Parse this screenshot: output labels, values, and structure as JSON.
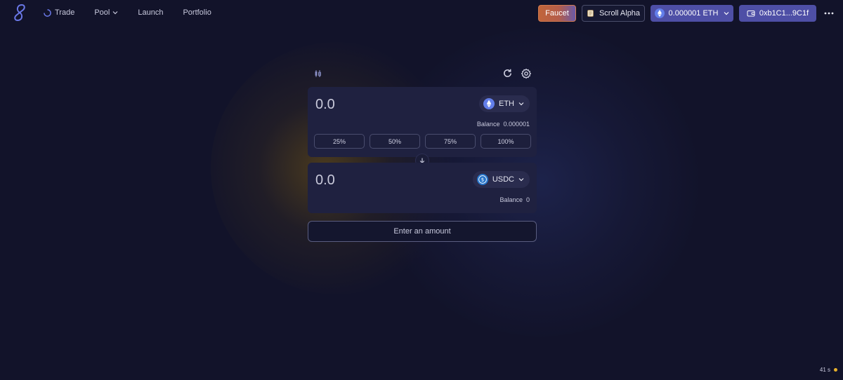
{
  "nav": {
    "items": [
      {
        "label": "Trade",
        "icon": "spinner-icon"
      },
      {
        "label": "Pool",
        "icon": "chevron-down-icon"
      },
      {
        "label": "Launch"
      },
      {
        "label": "Portfolio"
      }
    ]
  },
  "header": {
    "faucet_label": "Faucet",
    "network_label": "Scroll Alpha",
    "balance_label": "0.000001 ETH",
    "wallet_label": "0xb1C1...9C1f"
  },
  "swap": {
    "from": {
      "amount": "0.0",
      "token": "ETH",
      "balance_label": "Balance",
      "balance_value": "0.000001",
      "percent_buttons": [
        "25%",
        "50%",
        "75%",
        "100%"
      ]
    },
    "to": {
      "amount": "0.0",
      "token": "USDC",
      "balance_label": "Balance",
      "balance_value": "0"
    },
    "submit_label": "Enter an amount"
  },
  "status": {
    "block_time": "41 s",
    "dot_color": "#e8b12c"
  },
  "colors": {
    "accent": "#4e4fa6",
    "background": "#12132a",
    "panel": "#1f2140",
    "eth_icon": "#627eea",
    "usdc_icon": "#2775ca"
  }
}
